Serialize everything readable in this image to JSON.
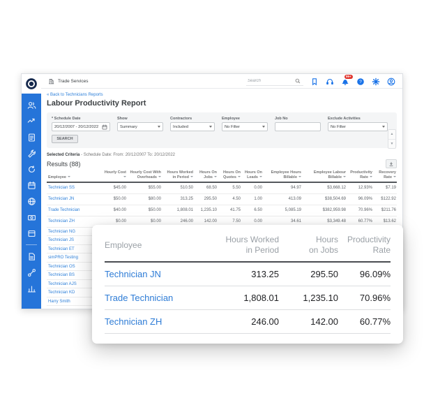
{
  "topbar": {
    "company": "Trade Services",
    "search_placeholder": "Search",
    "badge": "99+",
    "icons": [
      "bookmark",
      "headset",
      "notifications",
      "help",
      "settings",
      "account"
    ]
  },
  "sidebar": {
    "icons": [
      "people",
      "leads",
      "quotes",
      "jobs",
      "recurring",
      "schedule",
      "projects",
      "invoices",
      "catalog",
      "reports",
      "connect",
      "analytics"
    ]
  },
  "page": {
    "back_link": "« Back to Technicians Reports",
    "title": "Labour Productivity Report"
  },
  "filters": {
    "fields": [
      {
        "label": "* Schedule Date",
        "value": "20/12/2007 - 20/12/2022",
        "type": "date"
      },
      {
        "label": "Show",
        "value": "Summary",
        "type": "select"
      },
      {
        "label": "Contractors",
        "value": "Included",
        "type": "select"
      },
      {
        "label": "Employee",
        "value": "No Filter",
        "type": "select"
      },
      {
        "label": "Job No",
        "value": "",
        "type": "text"
      },
      {
        "label": "Exclude Activities",
        "value": "No Filter",
        "type": "select"
      }
    ],
    "search_button": "SEARCH"
  },
  "criteria": {
    "label": "Selected Criteria",
    "text": " - Schedule Date: From: 20/12/2007 To: 20/12/2022"
  },
  "results": {
    "title": "Results (88)",
    "columns": [
      "Employee",
      "Hourly Cost",
      "Hourly Cost With Overheads",
      "Hours Worked in Period",
      "Hours On Jobs",
      "Hours On Quotes",
      "Hours On Leads",
      "Employee Hours Billable",
      "Employee Labour Billable",
      "Productivity Rate",
      "Recovery Rate"
    ],
    "rows": [
      {
        "employee": "Technician SS",
        "cells": [
          "$45.00",
          "$55.00",
          "510.50",
          "68.50",
          "5.50",
          "0.00",
          "94.97",
          "$3,668.12",
          "12.93%",
          "$7.19"
        ]
      },
      {
        "employee": "Technician JN",
        "cells": [
          "$50.00",
          "$80.00",
          "313.25",
          "295.50",
          "4.50",
          "1.00",
          "413.09",
          "$38,504.69",
          "96.09%",
          "$122.92"
        ]
      },
      {
        "employee": "Trade Technician",
        "cells": [
          "$40.00",
          "$50.00",
          "1,808.01",
          "1,235.10",
          "41.75",
          "6.50",
          "5,085.19",
          "$382,959.98",
          "70.96%",
          "$211.76"
        ]
      },
      {
        "employee": "Technician ZH",
        "cells": [
          "$0.00",
          "$0.00",
          "246.00",
          "142.00",
          "7.50",
          "0.00",
          "34.61",
          "$3,349.48",
          "60.77%",
          "$13.62"
        ]
      }
    ],
    "more_employees": [
      "Technician NG",
      "Technician JS",
      "Technician ET",
      "simPRO Testing",
      "Technician OS",
      "Technician BS",
      "Technician AJS",
      "Technician KD",
      "Harry Smith"
    ]
  },
  "overlay": {
    "columns": [
      "Employee",
      "Hours Worked\nin Period",
      "Hours\non Jobs",
      "Productivity\nRate"
    ],
    "rows": [
      {
        "employee": "Technician JN",
        "values": [
          "313.25",
          "295.50",
          "96.09%"
        ]
      },
      {
        "employee": "Trade Technician",
        "values": [
          "1,808.01",
          "1,235.10",
          "70.96%"
        ]
      },
      {
        "employee": "Technician ZH",
        "values": [
          "246.00",
          "142.00",
          "60.77%"
        ]
      }
    ]
  },
  "colors": {
    "sidebar_blue": "#2574d9",
    "link_blue": "#2f80d9",
    "accent_blue": "#1a73e8",
    "badge_red": "#e0332c"
  }
}
